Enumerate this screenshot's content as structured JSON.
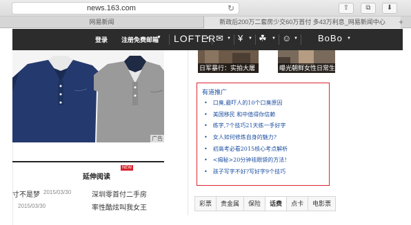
{
  "browser": {
    "url": "news.163.com",
    "tabs": [
      "网易新闻",
      "新政后200万二套房少交60万首付 多43万利息_网易新闻中心"
    ],
    "new_tab": "+"
  },
  "nav": {
    "login": "登录",
    "register": "注册免费邮箱",
    "lofter": "LOFTER",
    "bobo": "BoBo"
  },
  "thumbs": [
    {
      "caption": "日军暴行：实拍大屠杀"
    },
    {
      "caption": "曝光朝鲜女性日常生活"
    }
  ],
  "shirt_ad": {
    "ad_tag": "广告"
  },
  "promo": {
    "title": "有道推广",
    "items": [
      "口臭,最吓人的10个口臭原因",
      "美国移民 和中值得你信赖",
      "练字,7个技巧21天练一手好字",
      "女人如何修炼自身的魅力?",
      "初高考必看2015核心考点解析",
      "<揭秘>20分钟祛眼袋的方法！",
      "孩子写字不好?写好字9个技巧"
    ]
  },
  "extended": {
    "title": "延伸阅读",
    "badge": "NEW",
    "left_items": [
      {
        "text": "寸不是梦",
        "date": "2015/03/30"
      },
      {
        "date": "2015/03/30"
      }
    ],
    "right_items": [
      "深圳零首付二手房",
      "率性酷炫叫我女王"
    ]
  },
  "bottom_tabs": [
    "彩票",
    "贵金属",
    "保险",
    "话费",
    "点卡",
    "电影票"
  ],
  "bottom_tabs_active": "话费"
}
